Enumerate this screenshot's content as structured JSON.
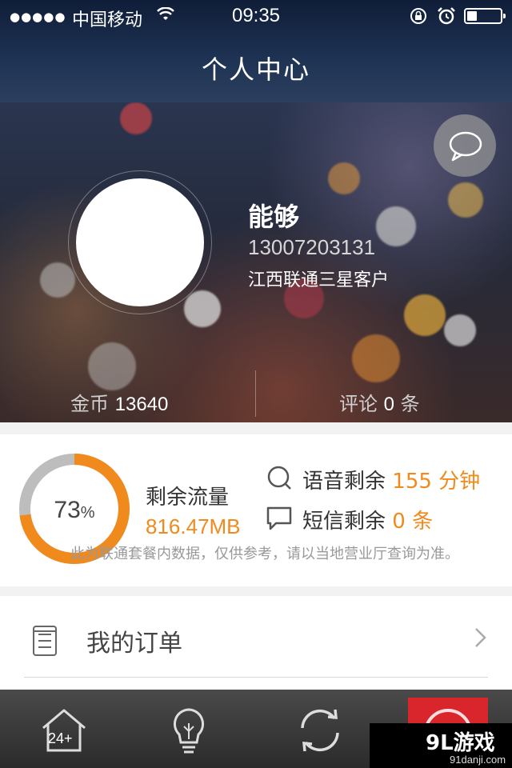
{
  "status_bar": {
    "signal": "●●●●●",
    "carrier": "中国移动",
    "time": "09:35"
  },
  "header": {
    "title": "个人中心"
  },
  "profile": {
    "name": "能够",
    "phone": "13007203131",
    "customer_type": "江西联通三星客户",
    "coins_label": "金币",
    "coins_value": "13640",
    "comments_label": "评论",
    "comments_value": "0",
    "comments_unit": "条"
  },
  "data_usage": {
    "percent": "73",
    "percent_sign": "%",
    "percent_fraction": 0.73,
    "remaining_label": "剩余流量",
    "remaining_value": "816.47MB",
    "voice_label": "语音剩余",
    "voice_value": "155 分钟",
    "sms_label": "短信剩余",
    "sms_value": "0 条",
    "note": "此为联通套餐内数据，仅供参考，请以当地营业厅查询为准。"
  },
  "orders": {
    "label": "我的订单"
  },
  "tabbar": {
    "home_badge": "24+"
  },
  "watermark": {
    "brand": "9L游戏",
    "site": "91danji.com"
  },
  "colors": {
    "accent": "#f08a1c",
    "tab_active": "#d9262c",
    "donut_track": "#bdbdbd"
  }
}
